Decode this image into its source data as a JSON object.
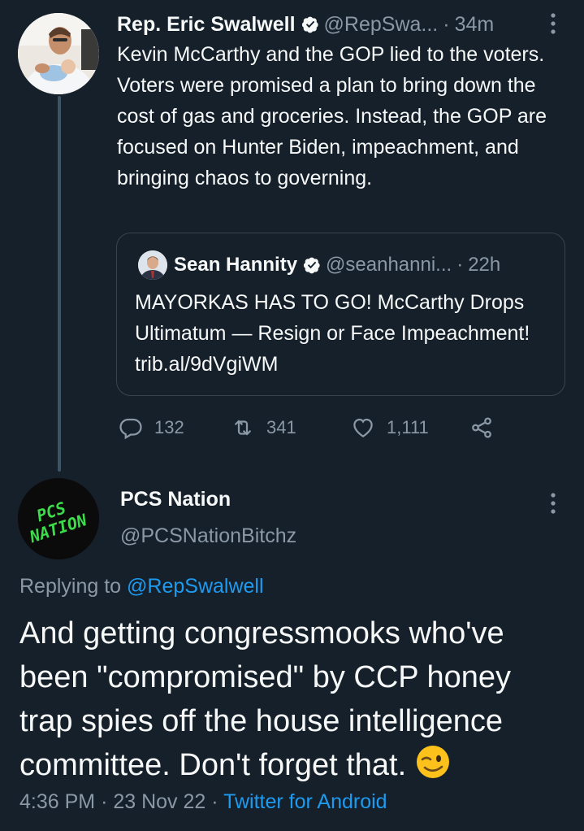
{
  "tweet": {
    "author_name": "Rep. Eric Swalwell",
    "handle": "@RepSwa...",
    "separator": "·",
    "time": "34m",
    "text": "Kevin McCarthy and the GOP lied to the voters. Voters were promised a plan to bring down the cost of gas and groceries. Instead, the GOP are focused on Hunter Biden, impeachment, and bringing chaos to governing."
  },
  "quoted": {
    "author_name": "Sean Hannity",
    "handle": "@seanhanni...",
    "separator": "·",
    "time": "22h",
    "text": "MAYORKAS HAS TO GO! McCarthy Drops Ultimatum — Resign or Face Impeachment! trib.al/9dVgiWM"
  },
  "actions": {
    "replies": "132",
    "retweets": "341",
    "likes": "1,111"
  },
  "reply": {
    "author_name": "PCS Nation",
    "handle": "@PCSNationBitchz",
    "replying_prefix": "Replying to",
    "replying_to": "@RepSwalwell",
    "text": "And getting congressmooks who've been \"compromised\" by CCP honey trap spies off the house intelligence committee. Don't forget that.",
    "time": "4:36 PM",
    "date": "23 Nov 22",
    "separator": "·",
    "source": "Twitter for Android",
    "avatar_lettering": "PCS NATION"
  },
  "colors": {
    "background": "#15202b",
    "text": "#f7f9f9",
    "muted": "#8b98a5",
    "link": "#1d9bf0",
    "border": "#38444d",
    "avatar_text": "#3ddc4a"
  },
  "icons": [
    "verified-badge-icon",
    "more-options-icon",
    "reply-icon",
    "retweet-icon",
    "like-icon",
    "share-icon",
    "wink-emoji-icon"
  ]
}
